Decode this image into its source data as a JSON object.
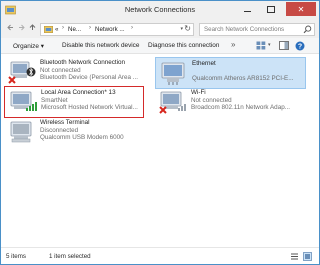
{
  "window": {
    "title": "Network Connections",
    "close_glyph": "✕"
  },
  "address_bar": {
    "segments": [
      "«",
      "Ne...",
      "Network ..."
    ],
    "separator": "›",
    "dropdown_glyph": "▾",
    "refresh_glyph": "↻"
  },
  "search": {
    "placeholder": "Search Network Connections"
  },
  "toolbar": {
    "organize_label": "Organize ▾",
    "disable_label": "Disable this network device",
    "diagnose_label": "Diagnose this connection",
    "more_glyph": "»"
  },
  "connections": [
    {
      "name": "Bluetooth Network Connection",
      "status": "Not connected",
      "device": "Bluetooth Device (Personal Area ...",
      "icon": "bluetooth-adapter-icon",
      "disconnected": true
    },
    {
      "name": "Ethernet",
      "status": "",
      "device": "Qualcomm Atheros AR8152 PCI-E...",
      "icon": "ethernet-adapter-icon",
      "selected": true
    },
    {
      "name": "Local Area Connection* 13",
      "status": "SmartNet",
      "device": "Microsoft Hosted Network Virtual...",
      "icon": "hosted-network-adapter-icon",
      "highlighted": true
    },
    {
      "name": "Wi-Fi",
      "status": "Not connected",
      "device": "Broadcom 802.11n Network Adap...",
      "icon": "wifi-adapter-icon",
      "disconnected": true
    },
    {
      "name": "Wireless Terminal",
      "status": "Disconnected",
      "device": "Qualcomm USB Modem 6000",
      "icon": "modem-adapter-icon",
      "disconnected": false
    }
  ],
  "status_bar": {
    "item_count": "5 items",
    "selected_count": "1 item selected"
  },
  "colors": {
    "selection_background": "#cce3f7",
    "selection_border": "#99c6ee",
    "highlight_box": "#d42a2a",
    "close_button": "#c74a45",
    "disconnected_mark": "#d7261d",
    "signal_bars": "#2f9e3b"
  }
}
